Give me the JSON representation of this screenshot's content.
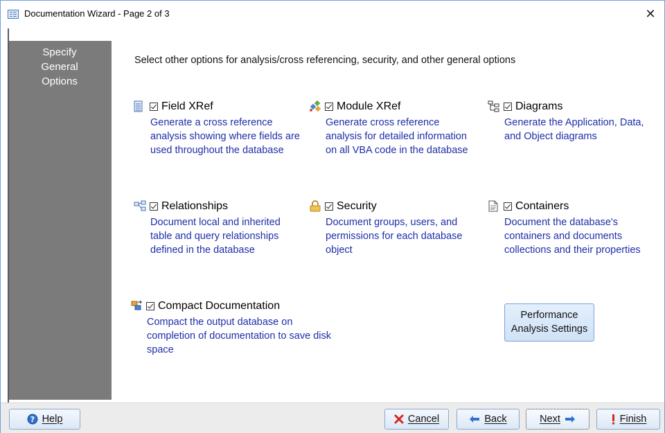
{
  "window": {
    "title": "Documentation Wizard - Page 2 of 3",
    "close_glyph": "✕"
  },
  "sidebar": {
    "title": "Specify\nGeneral\nOptions"
  },
  "main": {
    "instruction": "Select other options for analysis/cross referencing, security, and other general options",
    "options": [
      {
        "icon": "field-list-icon",
        "label": "Field XRef",
        "checked": true,
        "description": "Generate a cross reference analysis showing where fields are used throughout the database"
      },
      {
        "icon": "module-icon",
        "label": "Module XRef",
        "checked": true,
        "description": "Generate cross reference analysis for detailed information on all VBA code in the database"
      },
      {
        "icon": "diagram-icon",
        "label": "Diagrams",
        "checked": true,
        "description": "Generate the Application, Data, and Object diagrams"
      },
      {
        "icon": "relationships-icon",
        "label": "Relationships",
        "checked": true,
        "description": "Document local and inherited table and query relationships defined in the database"
      },
      {
        "icon": "lock-icon",
        "label": "Security",
        "checked": true,
        "description": "Document groups, users, and permissions for each database object"
      },
      {
        "icon": "document-icon",
        "label": "Containers",
        "checked": true,
        "description": "Document the database's containers and documents collections and their properties"
      },
      {
        "icon": "compact-icon",
        "label": "Compact Documentation",
        "checked": true,
        "description": "Compact the output database on completion of documentation to save disk space"
      }
    ],
    "performance_button": "Performance Analysis Settings"
  },
  "footer": {
    "help": "Help",
    "cancel": "Cancel",
    "back": "Back",
    "next": "Next",
    "finish": "Finish"
  },
  "colors": {
    "description_text": "#1e2ea8",
    "sidebar_bg": "#7b7b7b",
    "button_bg": "#dce8f6"
  }
}
